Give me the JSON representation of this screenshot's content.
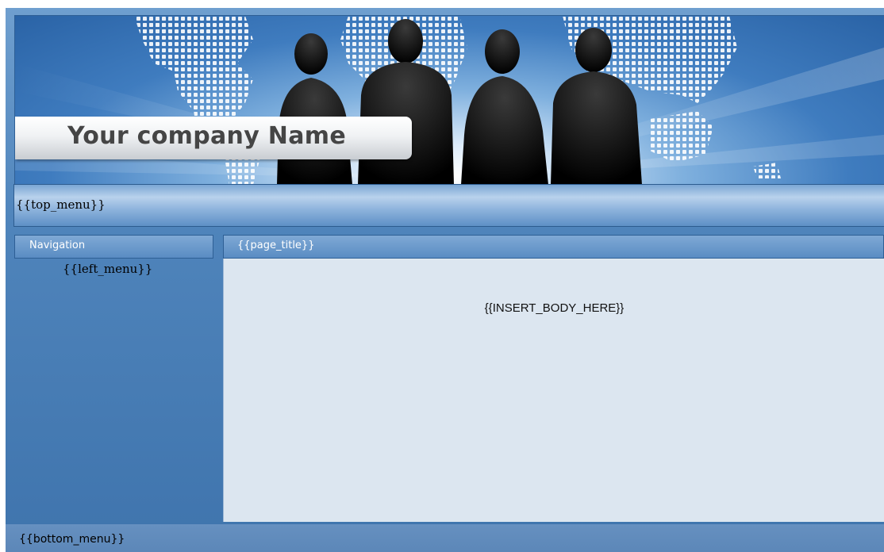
{
  "banner": {
    "company_name": "Your company Name",
    "image": "team-silhouettes-world-map"
  },
  "top_menu": {
    "placeholder": "{{top_menu}}"
  },
  "sidebar": {
    "header": "Navigation",
    "left_menu_placeholder": "{{left_menu}}"
  },
  "main": {
    "page_title": "{{page_title}}",
    "body_placeholder": "{{INSERT_BODY_HERE}}"
  },
  "footer": {
    "bottom_menu_placeholder": "{{bottom_menu}}"
  },
  "colors": {
    "frame_blue": "#4f84bb",
    "header_blue": "#5a8cc3",
    "content_bg": "#dce6f0"
  }
}
